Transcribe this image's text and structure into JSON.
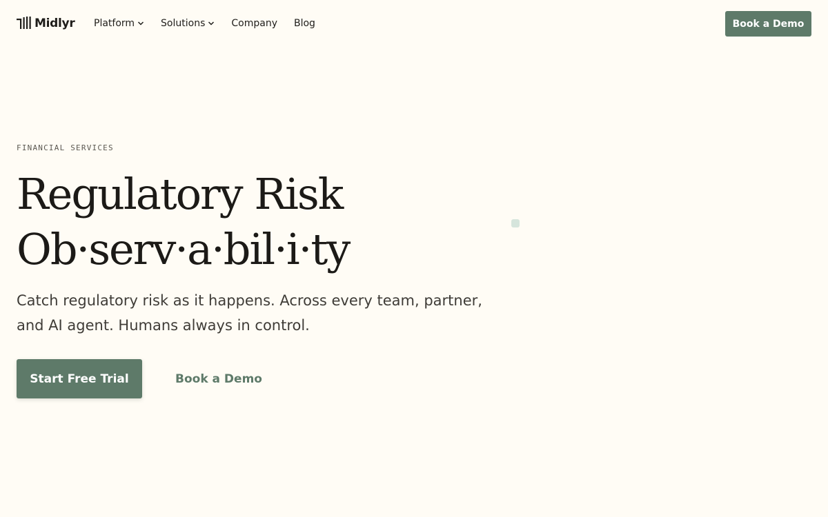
{
  "brand": {
    "name": "Midlyr",
    "accent_color": "#5e7a69",
    "background_color": "#fffcf5"
  },
  "nav": {
    "items": [
      {
        "label": "Platform",
        "has_dropdown": true
      },
      {
        "label": "Solutions",
        "has_dropdown": true
      },
      {
        "label": "Company",
        "has_dropdown": false
      },
      {
        "label": "Blog",
        "has_dropdown": false
      }
    ],
    "cta_label": "Book a Demo"
  },
  "hero": {
    "eyebrow": "FINANCIAL SERVICES",
    "headline_line1": "Regulatory Risk",
    "headline_line2": "Ob·serv·a·bil·i·ty",
    "subtext": "Catch regulatory risk as it happens. Across every team, partner, and AI agent. Humans always in control.",
    "primary_cta": "Start Free Trial",
    "secondary_cta": "Book a Demo"
  },
  "icons": {
    "logo": "midlyr-logo-mark-icon",
    "dropdown": "chevron-down-icon"
  }
}
